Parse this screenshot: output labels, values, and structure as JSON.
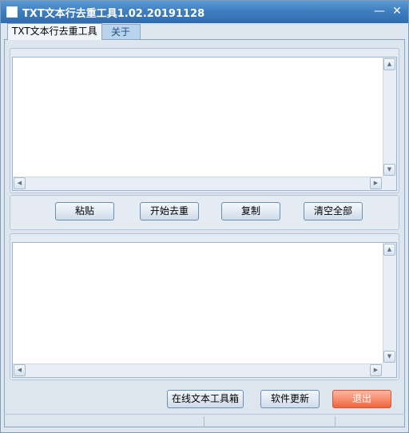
{
  "window": {
    "title": "TXT文本行去重工具1.02.20191128",
    "minimize_symbol": "—",
    "close_symbol": "✕"
  },
  "tabs": [
    {
      "label": "TXT文本行去重工具",
      "active": true
    },
    {
      "label": "关于",
      "active": false
    }
  ],
  "input_area": {
    "value": ""
  },
  "output_area": {
    "value": ""
  },
  "actions": {
    "paste": "粘贴",
    "start_dedupe": "开始去重",
    "copy": "复制",
    "clear_all": "清空全部"
  },
  "footer": {
    "online_toolbox": "在线文本工具箱",
    "software_update": "软件更新",
    "exit": "退出"
  },
  "icons": {
    "scroll_up": "▲",
    "scroll_down": "▼",
    "scroll_left": "◀",
    "scroll_right": "▶"
  },
  "colors": {
    "titlebar": "#3f7fc0",
    "background": "#dde6ef",
    "exit_button": "#f0643f"
  }
}
